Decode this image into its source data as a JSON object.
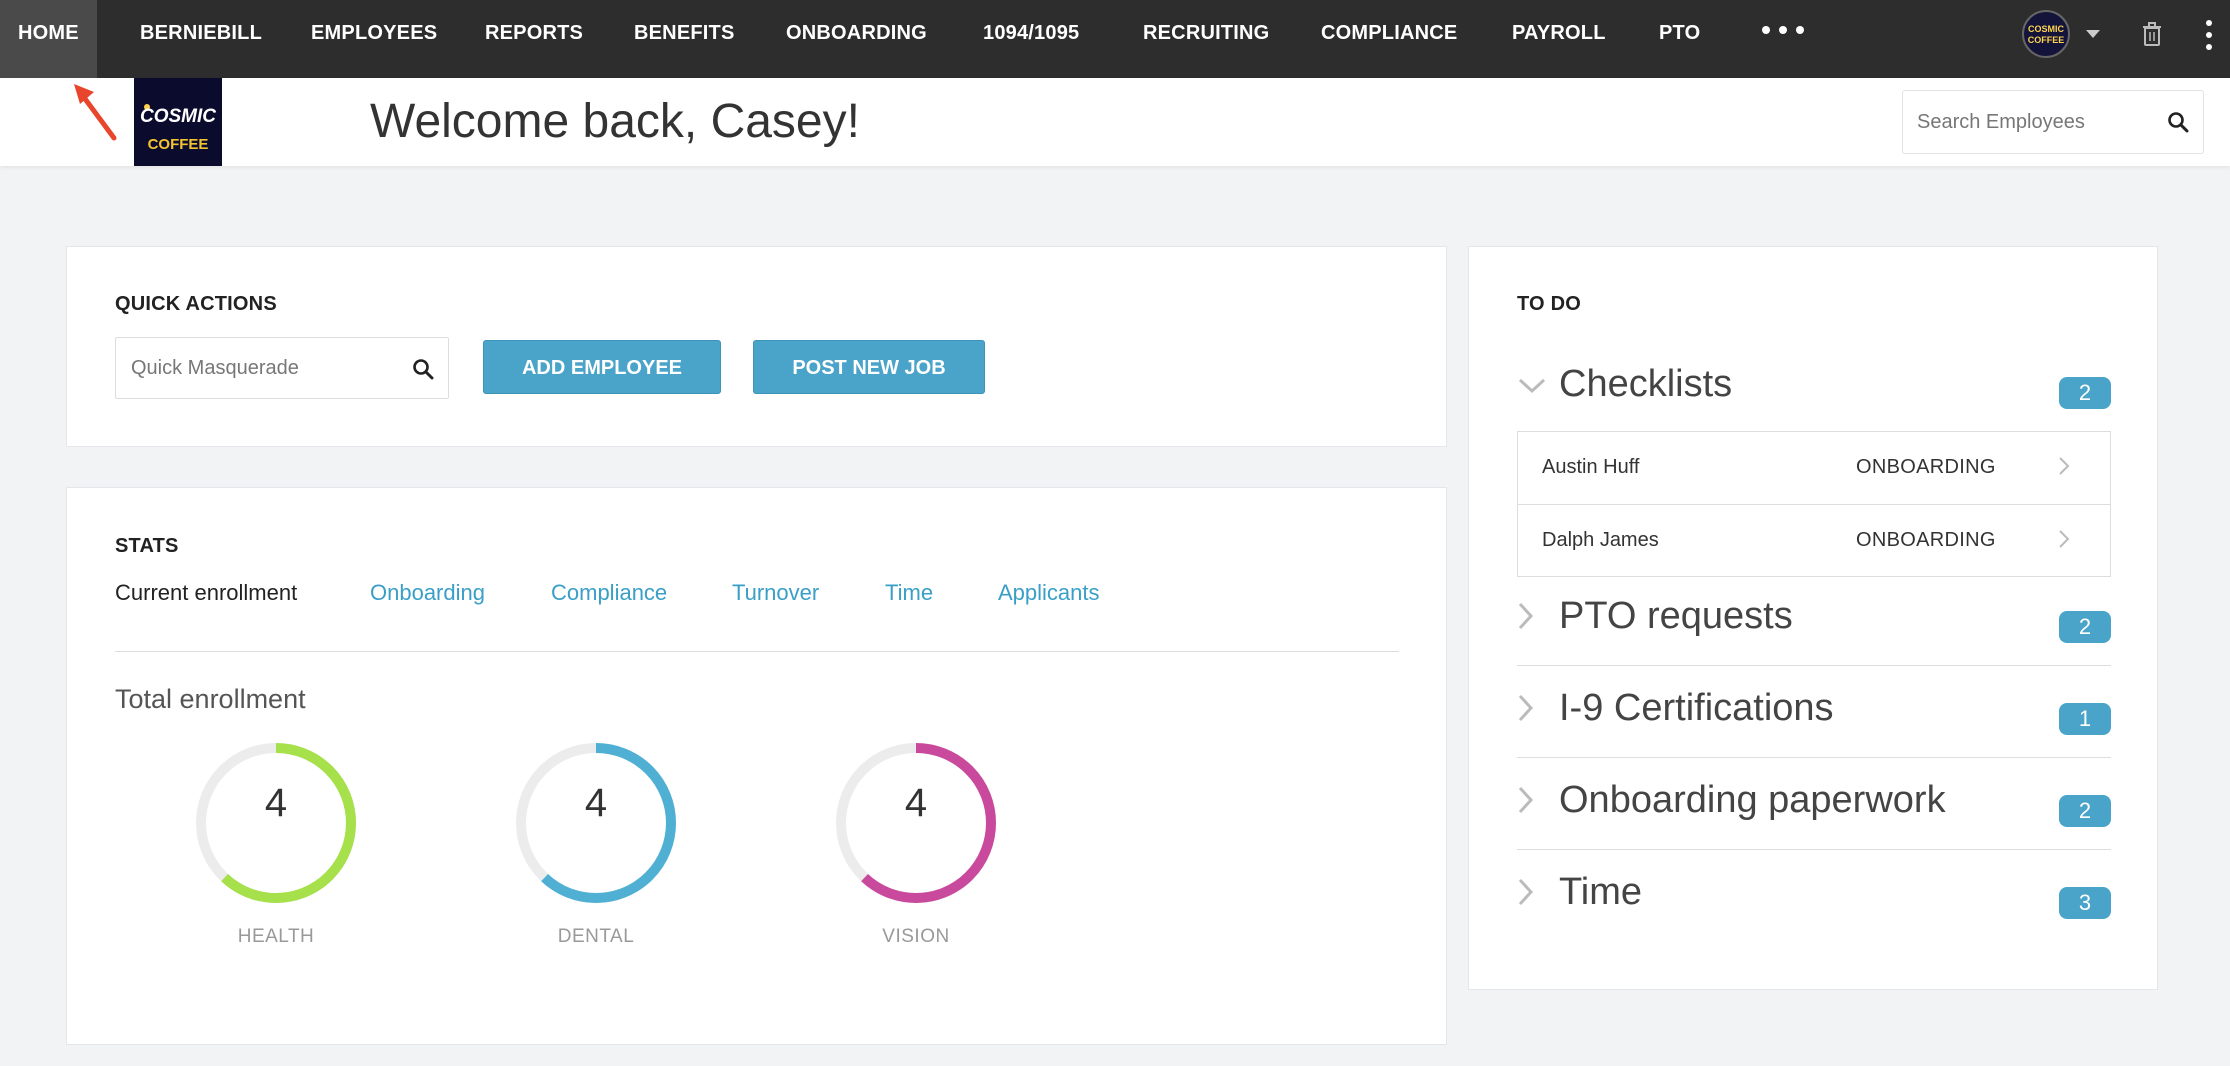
{
  "nav": {
    "items": [
      "HOME",
      "BERNIEBILL",
      "EMPLOYEES",
      "REPORTS",
      "BENEFITS",
      "ONBOARDING",
      "1094/1095",
      "RECRUITING",
      "COMPLIANCE",
      "PAYROLL",
      "PTO"
    ],
    "active": "HOME",
    "avatar_text_1": "COSMIC",
    "avatar_text_2": "COFFEE"
  },
  "header": {
    "logo_line1": "COSMIC",
    "logo_line2": "COFFEE",
    "welcome": "Welcome back, Casey!",
    "search_placeholder": "Search Employees"
  },
  "quick_actions": {
    "title": "QUICK ACTIONS",
    "masquerade_placeholder": "Quick Masquerade",
    "add_employee": "ADD EMPLOYEE",
    "post_new_job": "POST NEW JOB"
  },
  "stats": {
    "title": "STATS",
    "tabs": [
      "Current enrollment",
      "Onboarding",
      "Compliance",
      "Turnover",
      "Time",
      "Applicants"
    ],
    "active_tab": "Current enrollment",
    "section_title": "Total enrollment",
    "donuts": [
      {
        "label": "HEALTH",
        "value": "4",
        "fill": 0.62,
        "color": "#a6e04a"
      },
      {
        "label": "DENTAL",
        "value": "4",
        "fill": 0.62,
        "color": "#4fb0d4"
      },
      {
        "label": "VISION",
        "value": "4",
        "fill": 0.62,
        "color": "#c94a9c"
      }
    ]
  },
  "todo": {
    "title": "TO DO",
    "sections": [
      {
        "label": "Checklists",
        "count": "2",
        "expanded": true
      },
      {
        "label": "PTO requests",
        "count": "2",
        "expanded": false
      },
      {
        "label": "I-9 Certifications",
        "count": "1",
        "expanded": false
      },
      {
        "label": "Onboarding paperwork",
        "count": "2",
        "expanded": false
      },
      {
        "label": "Time",
        "count": "3",
        "expanded": false
      }
    ],
    "checklist_rows": [
      {
        "name": "Austin Huff",
        "type": "ONBOARDING"
      },
      {
        "name": "Dalph James",
        "type": "ONBOARDING"
      }
    ]
  },
  "colors": {
    "accent": "#4aa3c8",
    "nav_bg": "#2d2d2d",
    "annotation_arrow": "#e8452c"
  }
}
